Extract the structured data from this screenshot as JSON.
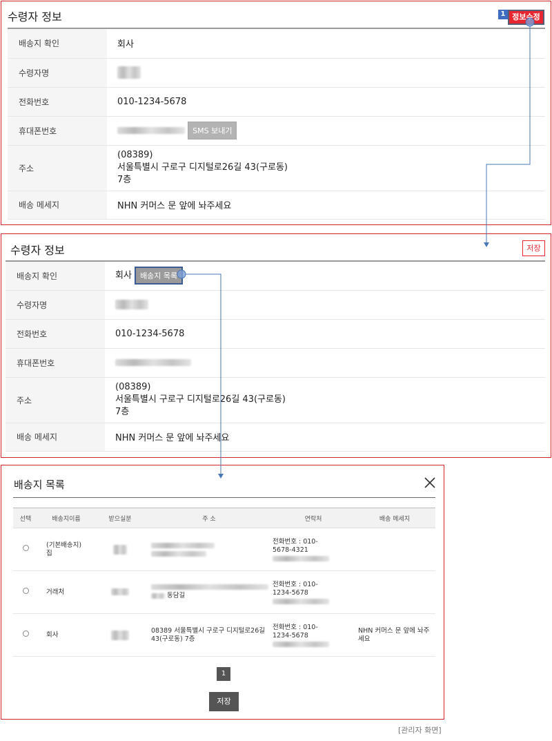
{
  "panel1": {
    "title": "수령자 정보",
    "step_badge": "1",
    "edit_button": "정보수정",
    "rows": {
      "delivery_label": "배송지 확인",
      "delivery_value": "회사",
      "name_label": "수령자명",
      "phone_label": "전화번호",
      "phone_value": "010-1234-5678",
      "mobile_label": "휴대폰번호",
      "sms_button": "SMS 보내기",
      "address_label": "주소",
      "address_zip": "(08389)",
      "address_line1": "서울특별시 구로구 디지털로26길 43(구로동)",
      "address_line2": "7층",
      "message_label": "배송 메세지",
      "message_value": "NHN 커머스 문 앞에 놔주세요"
    }
  },
  "panel2": {
    "title": "수령자 정보",
    "save_button": "저장",
    "rows": {
      "delivery_label": "배송지 확인",
      "delivery_value": "회사",
      "list_button": "배송지 목록",
      "name_label": "수령자명",
      "phone_label": "전화번호",
      "phone_value": "010-1234-5678",
      "mobile_label": "휴대폰번호",
      "address_label": "주소",
      "address_zip": "(08389)",
      "address_line1": "서울특별시 구로구 디지털로26길 43(구로동)",
      "address_line2": "7층",
      "message_label": "배송 메세지",
      "message_value": "NHN 커머스 문 앞에 놔주세요"
    }
  },
  "modal": {
    "title": "배송지 목록",
    "columns": [
      "선택",
      "배송지이름",
      "받으실분",
      "주 소",
      "연락처",
      "배송 메세지"
    ],
    "rows": [
      {
        "name_line1": "(기본배송지)",
        "name_line2": "집",
        "address_suffix": "",
        "phone_prefix": "전화번호 : 010-",
        "phone_line2": "5678-4321",
        "message": ""
      },
      {
        "name_line1": "거래처",
        "name_line2": "",
        "address_suffix": "동담길",
        "phone_prefix": "전화번호 : 010-",
        "phone_line2": "1234-5678",
        "message": ""
      },
      {
        "name_line1": "회사",
        "name_line2": "",
        "address_suffix": "08389 서울특별시 구로구 디지털로26길 43(구로동) 7층",
        "phone_prefix": "전화번호 : 010-",
        "phone_line2": "1234-5678",
        "message": "NHN 커머스 문 앞에 놔주세요"
      }
    ],
    "page": "1",
    "save_button": "저장"
  },
  "caption": "[관리자 화면]",
  "colors": {
    "highlight": "#d9222e",
    "accent": "#3d6cc0",
    "connector": "#4a77b8"
  }
}
